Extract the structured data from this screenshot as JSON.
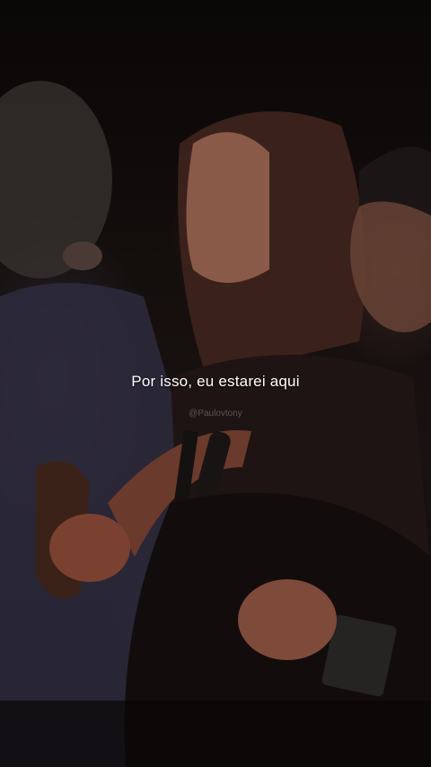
{
  "video": {
    "caption": "Por isso, eu estarei aqui",
    "watermark": "@Paulovtony"
  },
  "colors": {
    "background": "#0b0909",
    "caption_text": "#ffffff"
  }
}
